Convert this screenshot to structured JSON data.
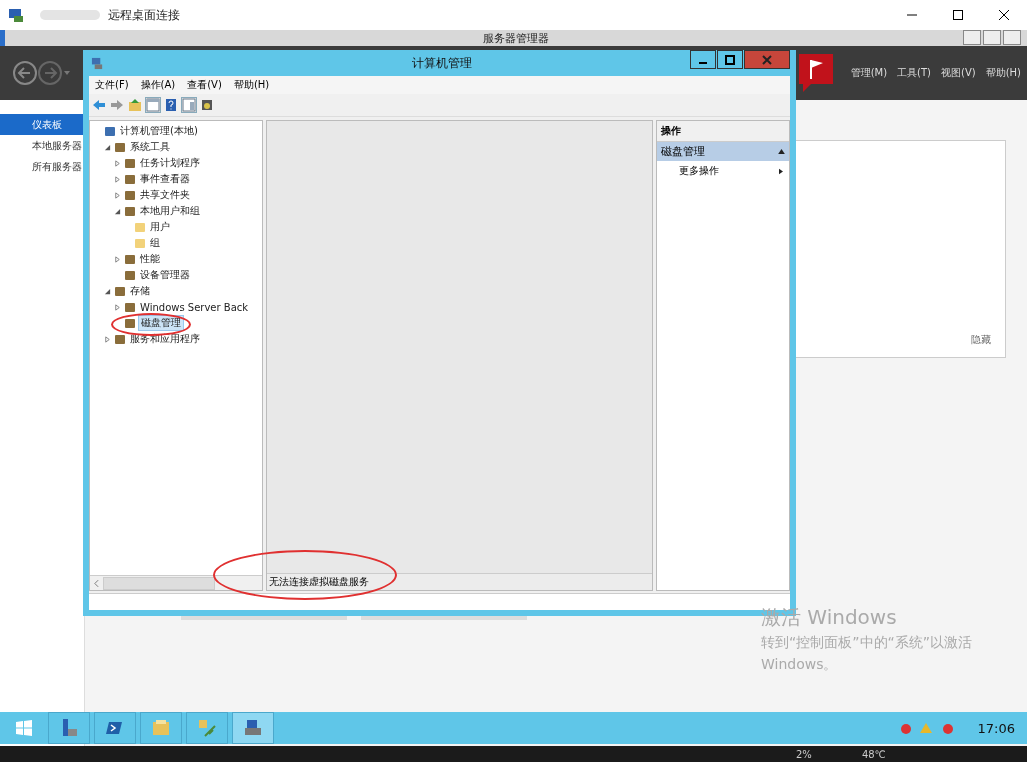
{
  "rdp_window": {
    "title": "远程桌面连接"
  },
  "server_manager": {
    "title": "服务器管理器",
    "menus": [
      "管理(M)",
      "工具(T)",
      "视图(V)",
      "帮助(H)"
    ],
    "sidebar": [
      {
        "label": "仪表板",
        "selected": true
      },
      {
        "label": "本地服务器",
        "selected": false
      },
      {
        "label": "所有服务器",
        "selected": false
      }
    ],
    "hide_link": "隐藏"
  },
  "computer_management": {
    "title": "计算机管理",
    "menus": [
      "文件(F)",
      "操作(A)",
      "查看(V)",
      "帮助(H)"
    ],
    "tree": [
      {
        "label": "计算机管理(本地)",
        "kind": "computer",
        "selected": false,
        "children": [
          {
            "label": "系统工具",
            "kind": "tool",
            "expanded": true,
            "selected": false,
            "children": [
              {
                "label": "任务计划程序",
                "kind": "tool",
                "expanded": false,
                "selected": false
              },
              {
                "label": "事件查看器",
                "kind": "tool",
                "expanded": false,
                "selected": false
              },
              {
                "label": "共享文件夹",
                "kind": "tool",
                "expanded": false,
                "selected": false
              },
              {
                "label": "本地用户和组",
                "kind": "tool",
                "expanded": true,
                "selected": false,
                "children": [
                  {
                    "label": "用户",
                    "kind": "folder",
                    "selected": false
                  },
                  {
                    "label": "组",
                    "kind": "folder",
                    "selected": false
                  }
                ]
              },
              {
                "label": "性能",
                "kind": "tool",
                "expanded": false,
                "selected": false
              },
              {
                "label": "设备管理器",
                "kind": "tool",
                "selected": false
              }
            ]
          },
          {
            "label": "存储",
            "kind": "tool",
            "expanded": true,
            "selected": false,
            "children": [
              {
                "label": "Windows Server Back",
                "kind": "tool",
                "expanded": false,
                "selected": false
              },
              {
                "label": "磁盘管理",
                "kind": "tool",
                "selected": true
              }
            ]
          },
          {
            "label": "服务和应用程序",
            "kind": "tool",
            "expanded": false,
            "selected": false
          }
        ]
      }
    ],
    "status": "无法连接虚拟磁盘服务",
    "actions": {
      "header": "操作",
      "section": "磁盘管理",
      "items": [
        "更多操作"
      ]
    }
  },
  "activation": {
    "title": "激活 Windows",
    "lines": [
      "转到“控制面板”中的“系统”以激活",
      "Windows。"
    ]
  },
  "taskbar": {
    "clock": "17:06"
  },
  "host_taskbar": {
    "readings": [
      "2%",
      "48℃"
    ]
  }
}
